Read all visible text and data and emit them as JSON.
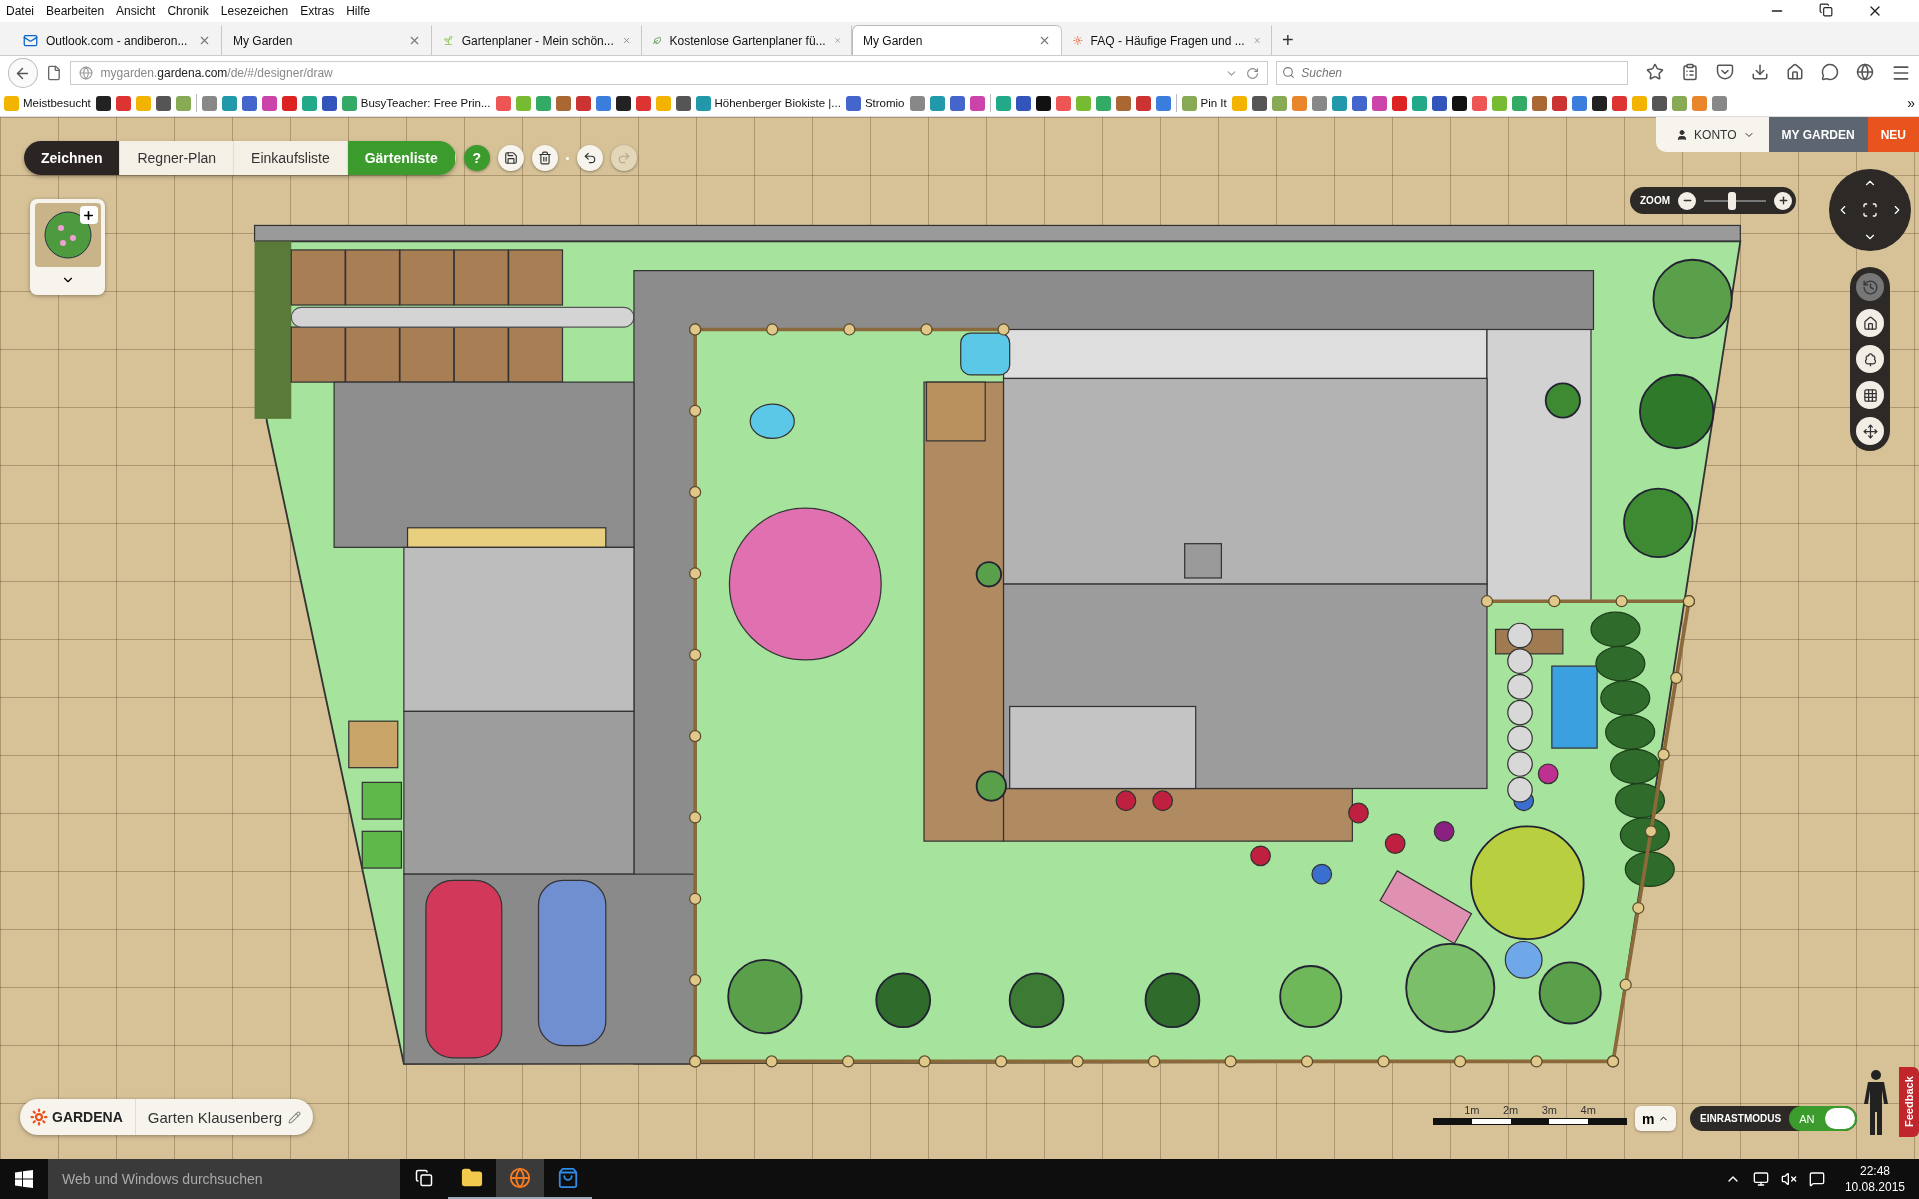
{
  "menu_bar": [
    "Datei",
    "Bearbeiten",
    "Ansicht",
    "Chronik",
    "Lesezeichen",
    "Extras",
    "Hilfe"
  ],
  "tabs": [
    {
      "title": "Outlook.com - andiberon...",
      "kind": "mail",
      "selected": false
    },
    {
      "title": "My Garden",
      "kind": "none",
      "selected": false
    },
    {
      "title": "Gartenplaner - Mein schön...",
      "kind": "letter",
      "selected": false
    },
    {
      "title": "Kostenlose Gartenplaner fü...",
      "kind": "leaf",
      "selected": false
    },
    {
      "title": "My Garden",
      "kind": "none",
      "selected": true
    },
    {
      "title": "FAQ - Häufige Fragen und ...",
      "kind": "sun",
      "selected": false
    }
  ],
  "new_tab": "+",
  "address_bar": {
    "url_prefix": "mygarden.",
    "url_domain": "gardena.com",
    "url_path": "/de/#/designer/draw"
  },
  "search": {
    "placeholder": "Suchen"
  },
  "bookmarks": [
    {
      "kind": "link",
      "label": "Meistbesucht"
    },
    {
      "kind": "icon"
    },
    {
      "kind": "icon"
    },
    {
      "kind": "icon"
    },
    {
      "kind": "icon"
    },
    {
      "kind": "icon"
    },
    {
      "kind": "separator"
    },
    {
      "kind": "icon"
    },
    {
      "kind": "icon"
    },
    {
      "kind": "icon"
    },
    {
      "kind": "icon"
    },
    {
      "kind": "icon"
    },
    {
      "kind": "icon"
    },
    {
      "kind": "icon"
    },
    {
      "kind": "link",
      "label": "BusyTeacher: Free Prin..."
    },
    {
      "kind": "icon"
    },
    {
      "kind": "icon"
    },
    {
      "kind": "icon"
    },
    {
      "kind": "icon"
    },
    {
      "kind": "icon"
    },
    {
      "kind": "icon"
    },
    {
      "kind": "icon"
    },
    {
      "kind": "icon"
    },
    {
      "kind": "icon"
    },
    {
      "kind": "icon"
    },
    {
      "kind": "link",
      "label": "Höhenberger Biokiste |..."
    },
    {
      "kind": "link",
      "label": "Stromio"
    },
    {
      "kind": "icon"
    },
    {
      "kind": "icon"
    },
    {
      "kind": "icon"
    },
    {
      "kind": "icon"
    },
    {
      "kind": "separator"
    },
    {
      "kind": "icon"
    },
    {
      "kind": "icon"
    },
    {
      "kind": "icon"
    },
    {
      "kind": "icon"
    },
    {
      "kind": "icon"
    },
    {
      "kind": "icon"
    },
    {
      "kind": "icon"
    },
    {
      "kind": "icon"
    },
    {
      "kind": "icon"
    },
    {
      "kind": "separator"
    },
    {
      "kind": "link",
      "label": "Pin It"
    },
    {
      "kind": "icon"
    },
    {
      "kind": "icon"
    },
    {
      "kind": "icon"
    },
    {
      "kind": "icon"
    },
    {
      "kind": "icon"
    },
    {
      "kind": "icon"
    },
    {
      "kind": "icon"
    },
    {
      "kind": "icon"
    },
    {
      "kind": "icon"
    },
    {
      "kind": "icon"
    },
    {
      "kind": "icon"
    },
    {
      "kind": "icon"
    },
    {
      "kind": "icon"
    },
    {
      "kind": "icon"
    },
    {
      "kind": "icon"
    },
    {
      "kind": "icon"
    },
    {
      "kind": "icon"
    },
    {
      "kind": "icon"
    },
    {
      "kind": "icon"
    },
    {
      "kind": "icon"
    },
    {
      "kind": "icon"
    },
    {
      "kind": "icon"
    },
    {
      "kind": "icon"
    },
    {
      "kind": "icon"
    },
    {
      "kind": "icon"
    }
  ],
  "bookmarks_overflow": "»",
  "app": {
    "mode_tabs": [
      {
        "label": "Zeichnen",
        "kind": "mode",
        "selected": true
      },
      {
        "label": "Regner-Plan",
        "kind": "mode",
        "selected": false
      },
      {
        "label": "Einkaufsliste",
        "kind": "mode",
        "selected": false
      },
      {
        "label": "Gärtenliste",
        "kind": "highlight",
        "selected": false
      }
    ],
    "help_label": "?",
    "tools": [
      {
        "kind": "save",
        "disabled": false
      },
      {
        "kind": "delete",
        "disabled": false
      },
      {
        "kind": "undo",
        "disabled": false
      },
      {
        "kind": "redo",
        "disabled": true
      }
    ],
    "account": "KONTO",
    "my_garden": "MY GARDEN",
    "new": "NEU",
    "zoom": {
      "label": "ZOOM",
      "level": 0.45
    },
    "side_tools": [
      {
        "kind": "history",
        "disabled": true
      },
      {
        "kind": "house",
        "disabled": false
      },
      {
        "kind": "tree",
        "disabled": false
      },
      {
        "kind": "grid",
        "disabled": false
      },
      {
        "kind": "plan",
        "disabled": false
      }
    ],
    "scale_labels": [
      "1m",
      "2m",
      "3m",
      "4m"
    ],
    "unit": "m",
    "snap": {
      "label": "EINRASTMODUS",
      "state": "AN",
      "on": true
    },
    "brand": "GARDENA",
    "garden_name": "Garten Klausenberg",
    "feedback": "Feedback"
  },
  "taskbar": {
    "search_placeholder": "Web und Windows durchsuchen",
    "apps": [
      {
        "kind": "explorer",
        "selected": false
      },
      {
        "kind": "firefox",
        "selected": true
      },
      {
        "kind": "store",
        "selected": false
      }
    ],
    "time": "22:48",
    "date": "10.08.2015"
  }
}
